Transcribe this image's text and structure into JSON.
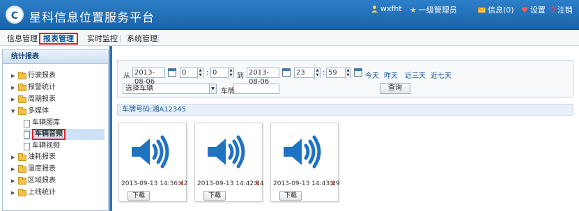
{
  "app": {
    "logo": "C",
    "title": "星科信息位置服务平台"
  },
  "header_right": [
    {
      "label": "wxfht",
      "icon": "user-icon",
      "color": "#ffd24a"
    },
    {
      "label": "一级管理员",
      "icon": "star-icon",
      "color": "#ffd24a"
    },
    {
      "label": "信息(0)",
      "icon": "mail-icon",
      "color": "#ffd24a"
    },
    {
      "label": "设置",
      "icon": "heart-icon",
      "color": "#ff5a5a"
    },
    {
      "label": "注销",
      "icon": "power-icon",
      "color": "#ff4040"
    }
  ],
  "nav": {
    "tabs": [
      "信息管理",
      "报表管理",
      "实时监控",
      "系统管理"
    ],
    "active": "报表管理"
  },
  "sidebar": {
    "title": "统计报表",
    "items": [
      "行驶报表",
      "报警统计",
      "周期报表",
      "多媒体",
      "油耗报表",
      "温度报表",
      "区域报表",
      "上线统计"
    ],
    "multimedia_children": [
      "车辆图库",
      "车辆音频",
      "车辆视频"
    ],
    "selected": "车辆音频"
  },
  "filter": {
    "from_label": "从",
    "from_date": "2013-08-06",
    "from_hour": "0",
    "from_min": "0",
    "to_label": "到",
    "to_date": "2013-08-06",
    "to_hour": "23",
    "to_min": "59",
    "quick_links": [
      "今天",
      "昨天",
      "近三天",
      "近七天"
    ],
    "vehicle_select": "选择车辆",
    "plate_label": "车牌",
    "plate_value": "",
    "query_button": "查询"
  },
  "plate_bar": "车牌号码:湘A12345",
  "audio_cards": [
    {
      "timestamp": "2013-09-13 14:36:42",
      "download": "下载"
    },
    {
      "timestamp": "2013-09-13 14:42:54",
      "download": "下载"
    },
    {
      "timestamp": "2013-09-13 14:43:29",
      "download": "下载"
    }
  ],
  "colors": {
    "header": "#1a62a8",
    "accent": "#0a4f9a",
    "highlight_border": "#e02020",
    "speaker": "#1f73c4"
  }
}
